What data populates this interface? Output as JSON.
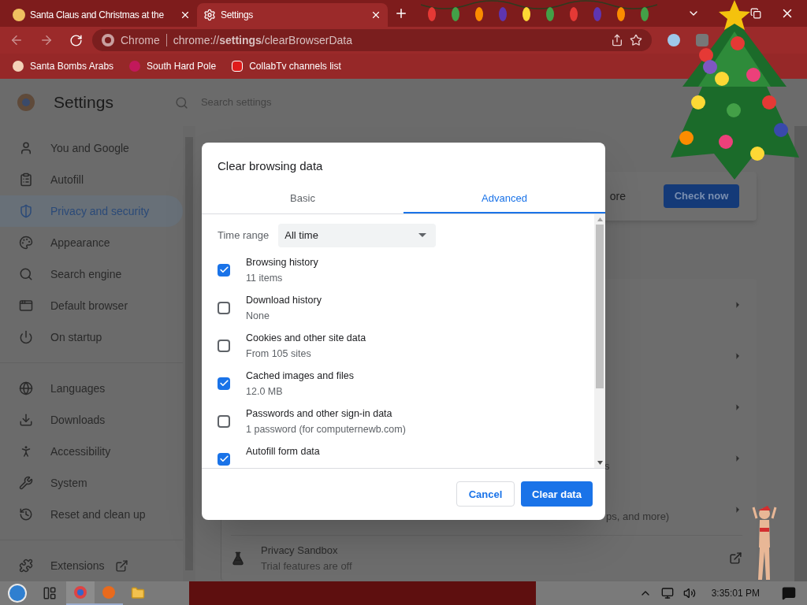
{
  "tabs": [
    {
      "title": "Santa Claus and Christmas at the",
      "selected": false
    },
    {
      "title": "Settings",
      "selected": true
    }
  ],
  "omnibox": {
    "site_label": "Chrome",
    "url": "chrome://**settings**/clearBrowserData"
  },
  "bookmarks": [
    "Santa Bombs Arabs",
    "South Hard Pole",
    "CollabTv channels list"
  ],
  "settings": {
    "title": "Settings",
    "search_placeholder": "Search settings",
    "sidebar": [
      [
        {
          "label": "You and Google",
          "selected": false
        },
        {
          "label": "Autofill",
          "selected": false
        },
        {
          "label": "Privacy and security",
          "selected": true
        },
        {
          "label": "Appearance",
          "selected": false
        },
        {
          "label": "Search engine",
          "selected": false
        },
        {
          "label": "Default browser",
          "selected": false
        },
        {
          "label": "On startup",
          "selected": false
        }
      ],
      [
        {
          "label": "Languages",
          "selected": false
        },
        {
          "label": "Downloads",
          "selected": false
        },
        {
          "label": "Accessibility",
          "selected": false
        },
        {
          "label": "System",
          "selected": false
        },
        {
          "label": "Reset and clean up",
          "selected": false
        }
      ],
      [
        {
          "label": "Extensions",
          "selected": false
        }
      ]
    ],
    "safety_check": {
      "partial_text": "ore",
      "button": "Check now"
    },
    "row_fragments": [
      "s",
      "ps, and more)"
    ],
    "privacy_sandbox": {
      "title": "Privacy Sandbox",
      "subtitle": "Trial features are off"
    }
  },
  "dialog": {
    "title": "Clear browsing data",
    "tabs": [
      {
        "label": "Basic",
        "selected": false
      },
      {
        "label": "Advanced",
        "selected": true
      }
    ],
    "time_range": {
      "label": "Time range",
      "value": "All time"
    },
    "items": [
      {
        "title": "Browsing history",
        "detail": "11 items",
        "checked": true
      },
      {
        "title": "Download history",
        "detail": "None",
        "checked": false
      },
      {
        "title": "Cookies and other site data",
        "detail": "From 105 sites",
        "checked": false
      },
      {
        "title": "Cached images and files",
        "detail": "12.0 MB",
        "checked": true
      },
      {
        "title": "Passwords and other sign-in data",
        "detail": "1 password (for computernewb.com)",
        "checked": false
      },
      {
        "title": "Autofill form data",
        "checked": true
      }
    ],
    "cancel": "Cancel",
    "confirm": "Clear data"
  },
  "taskbar": {
    "clock": "3:35:01 PM"
  }
}
